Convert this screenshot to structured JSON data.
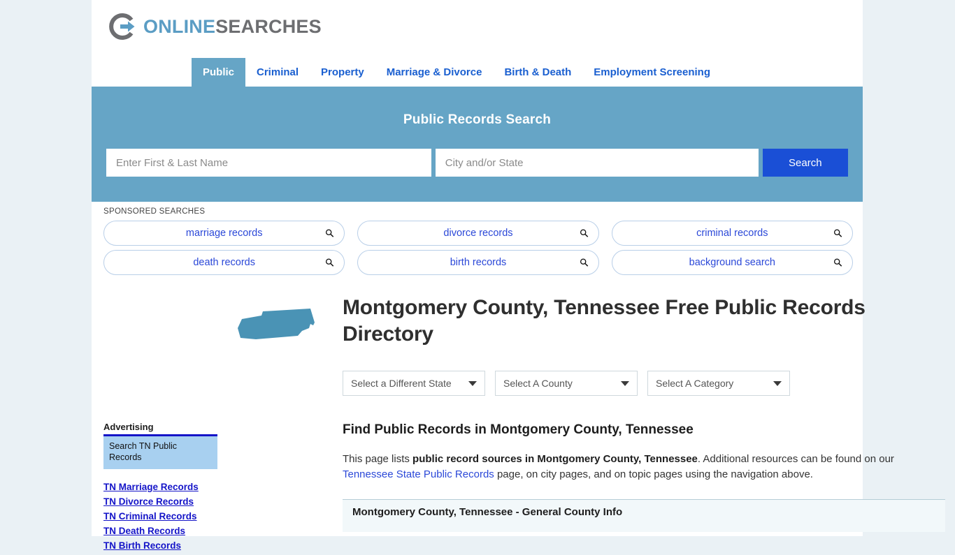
{
  "brand": {
    "part_a": "ONLINE",
    "part_b": "SEARCHES",
    "logo_icon": "circle-arrow-logo"
  },
  "nav": {
    "items": [
      {
        "label": "Public",
        "active": true
      },
      {
        "label": "Criminal",
        "active": false
      },
      {
        "label": "Property",
        "active": false
      },
      {
        "label": "Marriage & Divorce",
        "active": false
      },
      {
        "label": "Birth & Death",
        "active": false
      },
      {
        "label": "Employment Screening",
        "active": false
      }
    ]
  },
  "banner": {
    "title": "Public Records Search",
    "name_placeholder": "Enter First & Last Name",
    "name_value": "",
    "location_placeholder": "City and/or State",
    "location_value": "",
    "search_label": "Search",
    "bg_color": "#66a5c6",
    "button_color": "#1a4fd6"
  },
  "sponsored": {
    "label": "SPONSORED SEARCHES",
    "items": [
      {
        "label": "marriage records"
      },
      {
        "label": "divorce records"
      },
      {
        "label": "criminal records"
      },
      {
        "label": "death records"
      },
      {
        "label": "birth records"
      },
      {
        "label": "background search"
      }
    ]
  },
  "main": {
    "map_icon": "tennessee-state-outline",
    "title": "Montgomery County, Tennessee Free Public Records Directory",
    "selects": [
      {
        "value": "Select a Different State"
      },
      {
        "value": "Select A County"
      },
      {
        "value": "Select A Category"
      }
    ],
    "section_heading": "Find Public Records in Montgomery County, Tennessee",
    "paragraph": {
      "lead": "This page lists ",
      "bold": "public record sources in Montgomery County, Tennessee",
      "mid": ". Additional resources can be found on our ",
      "link": "Tennessee State Public Records",
      "tail": " page, on city pages, and on topic pages using the navigation above."
    },
    "table_heading": "Montgomery County, Tennessee - General County Info"
  },
  "sidebar": {
    "ad_label": "Advertising",
    "ad_box_text": "Search TN Public Records",
    "links": [
      {
        "label": "TN Marriage Records"
      },
      {
        "label": "TN Divorce Records"
      },
      {
        "label": "TN Criminal Records"
      },
      {
        "label": "TN Death Records"
      },
      {
        "label": "TN Birth Records"
      }
    ]
  }
}
